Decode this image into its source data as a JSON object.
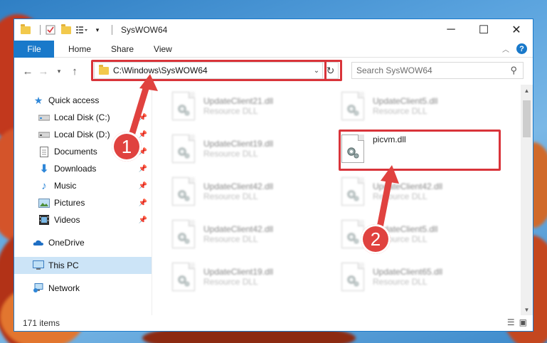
{
  "window": {
    "title": "SysWOW64"
  },
  "ribbon": {
    "tabs": [
      "File",
      "Home",
      "Share",
      "View"
    ],
    "help": "?"
  },
  "address": {
    "path": "C:\\Windows\\SysWOW64"
  },
  "search": {
    "placeholder": "Search SysWOW64"
  },
  "sidebar": {
    "items": [
      {
        "label": "Quick access",
        "icon": "star-icon"
      },
      {
        "label": "Local Disk (C:)",
        "icon": "drive-icon"
      },
      {
        "label": "Local Disk (D:)",
        "icon": "drive-icon"
      },
      {
        "label": "Documents",
        "icon": "documents-icon"
      },
      {
        "label": "Downloads",
        "icon": "downloads-icon"
      },
      {
        "label": "Music",
        "icon": "music-icon"
      },
      {
        "label": "Pictures",
        "icon": "pictures-icon"
      },
      {
        "label": "Videos",
        "icon": "videos-icon"
      },
      {
        "label": "OneDrive",
        "icon": "cloud-icon"
      },
      {
        "label": "This PC",
        "icon": "pc-icon"
      },
      {
        "label": "Network",
        "icon": "network-icon"
      }
    ]
  },
  "files": [
    {
      "name": "UpdateClient21.dll",
      "type": "Resource DLL"
    },
    {
      "name": "UpdateClient5.dll",
      "type": "Resource DLL"
    },
    {
      "name": "UpdateClient19.dll",
      "type": "Resource DLL"
    },
    {
      "name": "picvm.dll",
      "type": ""
    },
    {
      "name": "UpdateClient42.dll",
      "type": "Resource DLL"
    },
    {
      "name": "UpdateClient42.dll",
      "type": "Resource DLL"
    },
    {
      "name": "UpdateClient42.dll",
      "type": "Resource DLL"
    },
    {
      "name": "UpdateClient5.dll",
      "type": "Resource DLL"
    },
    {
      "name": "UpdateClient19.dll",
      "type": "Resource DLL"
    },
    {
      "name": "UpdateClient65.dll",
      "type": "Resource DLL"
    }
  ],
  "status": {
    "count": "171 items"
  },
  "annotations": {
    "marker1": "1",
    "marker2": "2",
    "color": "#e0423f"
  }
}
